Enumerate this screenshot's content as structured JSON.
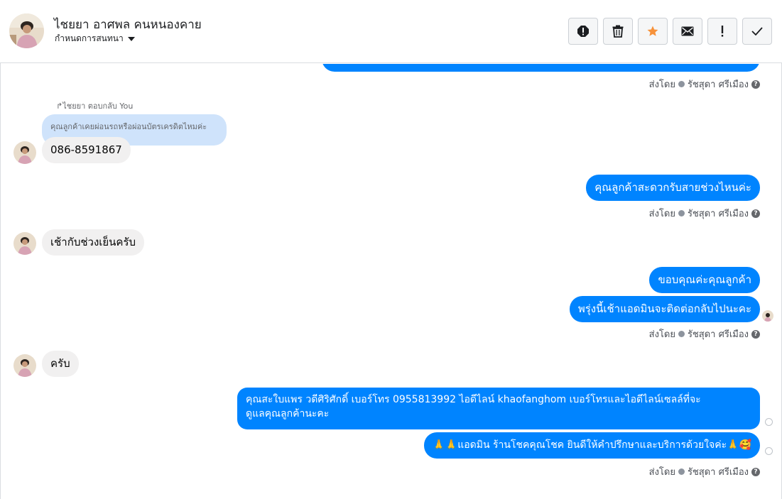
{
  "header": {
    "contact_name": "ไชยยา อาศพล คนหนองคาย",
    "subtitle": "กำหนดการสนทนา",
    "actions": [
      {
        "name": "spam-button",
        "icon": "alert-circle-icon"
      },
      {
        "name": "delete-button",
        "icon": "trash-icon"
      },
      {
        "name": "star-button",
        "icon": "star-icon"
      },
      {
        "name": "mark-unread-button",
        "icon": "envelope-icon"
      },
      {
        "name": "follow-up-button",
        "icon": "exclamation-icon"
      },
      {
        "name": "done-button",
        "icon": "checkmark-icon"
      }
    ]
  },
  "colors": {
    "outgoing_bubble": "#0084ff",
    "incoming_bubble": "#f1f0f0",
    "quote_bubble": "#cfe3fb",
    "star": "#f7923a"
  },
  "sent_by": {
    "prefix": "ส่งโดย",
    "agent": "รัชสุดา ศรีเมือง"
  },
  "messages": {
    "reply_label": "ไชยยา ตอบกลับ You",
    "quoted": "คุณลูกค้าเคยผ่อนรถหรือผ่อนบัตรเครดิตไหมค่ะ",
    "phone": "086-8591867",
    "ask_time": "คุณลูกค้าสะดวกรับสายช่วงไหนค่ะ",
    "reply_time": "เช้ากับช่วงเย็นครับ",
    "thanks": "ขอบคุณค่ะคุณลูกค้า",
    "callback": "พรุ่งนี้เช้าแอดมินจะติดต่อกลับไปนะคะ",
    "krub": "ครับ",
    "contact_line1": "คุณสะใบแพร วดีศิริศักดิ์ เบอร์โทร 0955813992  ไอดีไลน์  khaofanghom   เบอร์โทรและไอดีไลน์เซลล์ที่จะ",
    "contact_line2": "ดูแลคุณลูกค้านะคะ",
    "closing": "🙏🙏แอดมิน ร้านโชคคุณโชค ยินดีให้คำปรึกษาและบริการด้วยใจค่ะ🙏🥰"
  }
}
